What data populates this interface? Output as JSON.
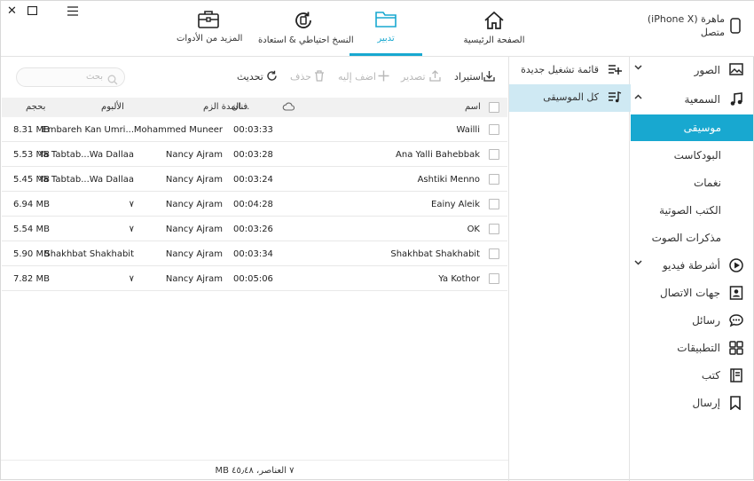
{
  "window": {
    "close": "✕",
    "maximize": "☐",
    "menu": "☰"
  },
  "tabs": [
    {
      "label": "الصفحة الرئيسية",
      "icon": "home-icon"
    },
    {
      "label": "تدبير",
      "icon": "folder-icon",
      "active": true
    },
    {
      "label": "النسخ احتياطي & استعادة",
      "icon": "backup-restore-icon"
    },
    {
      "label": "المزيد من الأدوات",
      "icon": "toolbox-icon"
    }
  ],
  "device": {
    "name": "ماهرة (iPhone X)",
    "status": "متصل"
  },
  "sidebar": {
    "items": [
      {
        "label": "الصور",
        "icon": "photo-icon",
        "chevron": "⌄"
      },
      {
        "label": "السمعية",
        "icon": "music-note-icon",
        "chevron": "⌃"
      },
      {
        "label": "أشرطة فيديو",
        "icon": "play-circle-icon",
        "chevron": "⌄"
      },
      {
        "label": "جهات الاتصال",
        "icon": "contacts-icon"
      },
      {
        "label": "رسائل",
        "icon": "message-icon"
      },
      {
        "label": "التطبيقات",
        "icon": "apps-grid-icon"
      },
      {
        "label": "كتب",
        "icon": "book-icon"
      },
      {
        "label": "إرسال",
        "icon": "bookmark-icon"
      }
    ],
    "audio_sub": [
      "موسيقى",
      "البودكاست",
      "نغمات",
      "الكتب الصوتية",
      "مذكرات الصوت"
    ]
  },
  "playlists": {
    "new_playlist": "قائمة تشغيل جديدة",
    "all_music": "كل الموسيقى"
  },
  "toolbar": {
    "import": "استيراد",
    "export": "تصدير",
    "add_to": "اضف إليه",
    "delete": "حذف",
    "refresh": "تحديث",
    "search_placeholder": "بحث"
  },
  "table": {
    "headers": {
      "name": "اسم",
      "duration": "المدة الزم...",
      "artist": "فنان",
      "album": "الألبوم",
      "size": "بحجم"
    },
    "rows": [
      {
        "name": "Wailli",
        "duration": "00:03:33",
        "artist": "Mohammed Muneer",
        "album": "Embareh Kan Umri...",
        "size": "8.31 MB"
      },
      {
        "name": "Ana Yalli Bahebbak",
        "duration": "00:03:28",
        "artist": "Nancy Ajram",
        "album": "Ya Tabtab...Wa Dallaa",
        "size": "5.53 MB"
      },
      {
        "name": "Ashtiki Menno",
        "duration": "00:03:24",
        "artist": "Nancy Ajram",
        "album": "Ya Tabtab...Wa Dallaa",
        "size": "5.45 MB"
      },
      {
        "name": "Eainy Aleik",
        "duration": "00:04:28",
        "artist": "Nancy Ajram",
        "album": "٧",
        "size": "6.94 MB"
      },
      {
        "name": "OK",
        "duration": "00:03:26",
        "artist": "Nancy Ajram",
        "album": "٧",
        "size": "5.54 MB"
      },
      {
        "name": "Shakhbat Shakhabit",
        "duration": "00:03:34",
        "artist": "Nancy Ajram",
        "album": "Shakhbat Shakhabit",
        "size": "5.90 MB"
      },
      {
        "name": "Ya Kothor",
        "duration": "00:05:06",
        "artist": "Nancy Ajram",
        "album": "٧",
        "size": "7.82 MB"
      }
    ]
  },
  "footer": "٧ العناصر، ٤٥٫٤٨ MB",
  "colors": {
    "accent": "#18a8d0",
    "selected_row": "#cfe9f3"
  }
}
